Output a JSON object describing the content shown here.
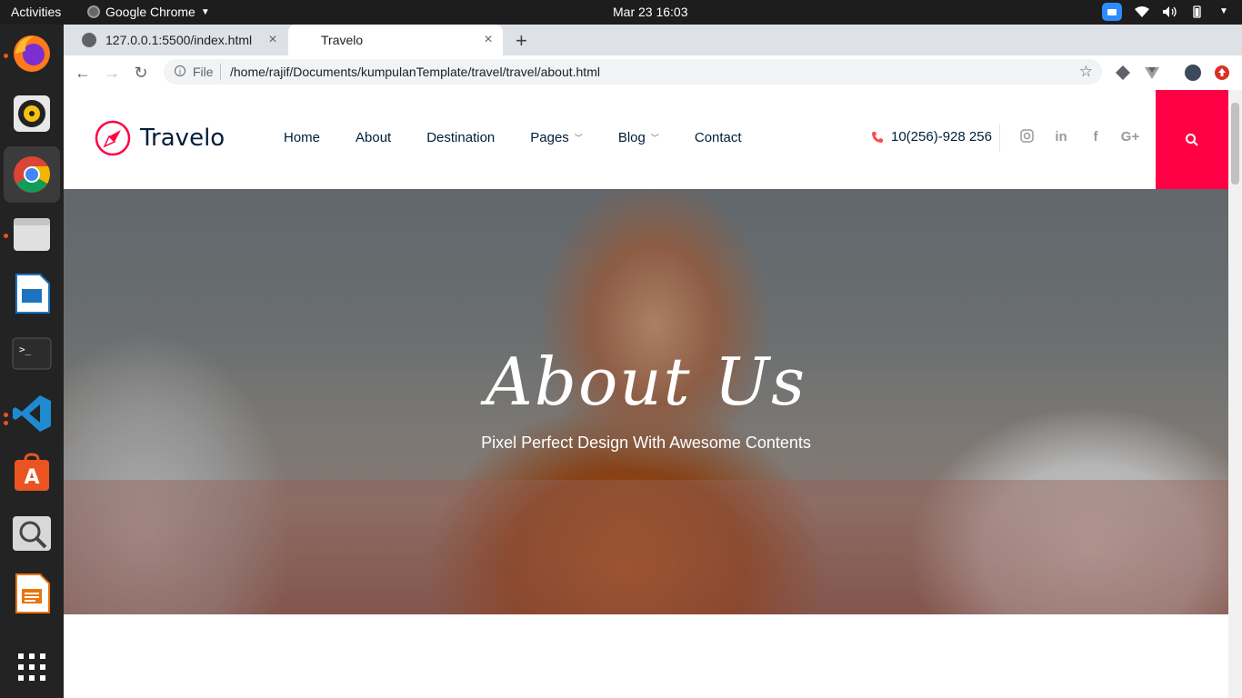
{
  "os_bar": {
    "activities": "Activities",
    "app_name": "Google Chrome",
    "clock": "Mar 23  16:03"
  },
  "tabs": [
    {
      "title": "127.0.0.1:5500/index.html"
    },
    {
      "title": "Travelo"
    }
  ],
  "address_bar": {
    "scheme_label": "File",
    "url": "/home/rajif/Documents/kumpulanTemplate/travel/travel/about.html"
  },
  "site": {
    "logo_text": "Travelo",
    "menu": [
      {
        "label": "Home",
        "has_dropdown": false
      },
      {
        "label": "About",
        "has_dropdown": false
      },
      {
        "label": "Destination",
        "has_dropdown": false
      },
      {
        "label": "Pages",
        "has_dropdown": true
      },
      {
        "label": "Blog",
        "has_dropdown": true
      },
      {
        "label": "Contact",
        "has_dropdown": false
      }
    ],
    "phone": "10(256)-928 256",
    "social": [
      "instagram-icon",
      "linkedin-icon",
      "facebook-icon",
      "google-plus-icon"
    ],
    "accent_color": "#ff0044"
  },
  "hero": {
    "title": "About Us",
    "subtitle": "Pixel Perfect Design With Awesome Contents"
  }
}
